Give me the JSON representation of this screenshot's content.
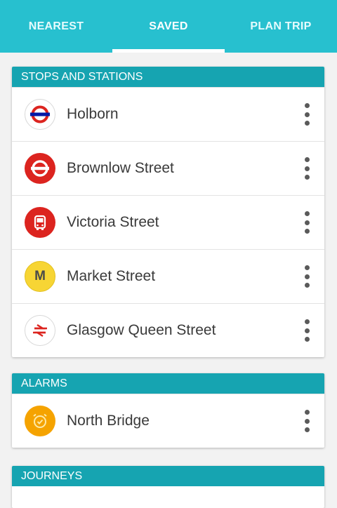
{
  "tabs": [
    {
      "label": "NEAREST"
    },
    {
      "label": "SAVED"
    },
    {
      "label": "PLAN TRIP"
    }
  ],
  "stops_section": {
    "header": "STOPS AND STATIONS",
    "items": [
      {
        "label": "Holborn",
        "icon": "underground-roundel-icon"
      },
      {
        "label": "Brownlow Street",
        "icon": "bus-roundel-icon"
      },
      {
        "label": "Victoria Street",
        "icon": "bus-icon"
      },
      {
        "label": "Market Street",
        "icon": "metro-m-icon",
        "icon_text": "M"
      },
      {
        "label": "Glasgow Queen Street",
        "icon": "national-rail-icon"
      }
    ]
  },
  "alarms_section": {
    "header": "ALARMS",
    "items": [
      {
        "label": "North Bridge",
        "icon": "alarm-clock-icon"
      }
    ]
  },
  "journeys_section": {
    "header": "JOURNEYS"
  },
  "colors": {
    "tab_bar": "#27c0cf",
    "section_header": "#16a4b1",
    "tfl_red": "#dc241f",
    "tfl_blue": "#0019a8",
    "metro_yellow": "#f7d534",
    "alarm_orange": "#f5a300"
  }
}
